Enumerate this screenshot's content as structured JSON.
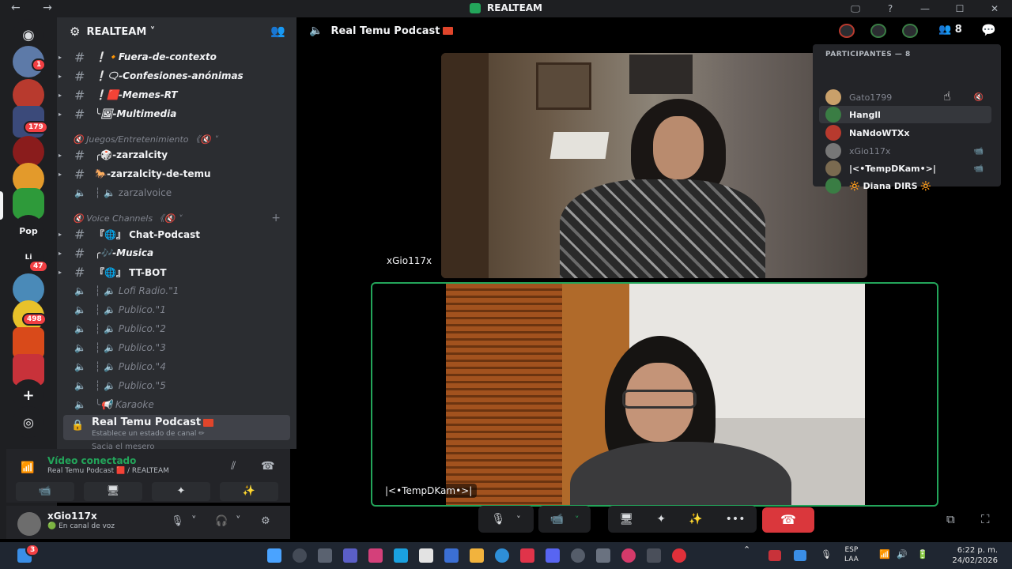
{
  "window": {
    "title": "REALTEAM",
    "nav_arrows": "← →",
    "controls": [
      "🖵",
      "?",
      "—",
      "☐",
      "✕"
    ]
  },
  "rail": {
    "badges": [
      "1",
      "179",
      "47",
      "498"
    ],
    "pop_label": "Pop",
    "li_label": "Li",
    "add_label": "+",
    "explore_label": "◎"
  },
  "guild": {
    "name": "REALTEAM ˅",
    "gear": "⚙",
    "invite": "👥"
  },
  "channels": [
    {
      "arrow": "▸",
      "name": "❕🔸Fuera-de-contexto"
    },
    {
      "arrow": "▸",
      "name": "❕🗨-Confesiones-anónimas"
    },
    {
      "arrow": "▸",
      "name": "❕🟥-Memes-RT"
    },
    {
      "arrow": "▸",
      "name": "╰🖼-Multimedia"
    }
  ],
  "categories": {
    "games": "🔇 Juegos/Entretenimiento 《🔇 ˅",
    "voice": "🔇 Voice Channels 《🔇 ˅"
  },
  "games_channels": [
    {
      "arrow": "▸",
      "icon": "#",
      "name": "╭🎲-zarzalcity"
    },
    {
      "arrow": "▸",
      "icon": "#",
      "name": "🐎-zarzalcity-de-temu"
    },
    {
      "arrow": "",
      "icon": "🔈",
      "name": "┆ 🔈 zarzalvoice"
    }
  ],
  "voice_channels": [
    {
      "arrow": "▸",
      "icon": "#",
      "name": "『🌐』 Chat-Podcast",
      "muted": false
    },
    {
      "arrow": "▸",
      "icon": "#",
      "name": "╭🎶-Musica",
      "muted": false
    },
    {
      "arrow": "▸",
      "icon": "#",
      "name": "『🌐』 TT-BOT",
      "muted": false
    },
    {
      "arrow": "",
      "icon": "🔈",
      "name": "┆ 🔈 Lofi Radio.\"1",
      "muted": true
    },
    {
      "arrow": "",
      "icon": "🔈",
      "name": "┆ 🔈 Publico.\"1",
      "muted": true
    },
    {
      "arrow": "",
      "icon": "🔈",
      "name": "┆ 🔈 Publico.\"2",
      "muted": true
    },
    {
      "arrow": "",
      "icon": "🔈",
      "name": "┆ 🔈 Publico.\"3",
      "muted": true
    },
    {
      "arrow": "",
      "icon": "🔈",
      "name": "┆ 🔈 Publico.\"4",
      "muted": true
    },
    {
      "arrow": "",
      "icon": "🔈",
      "name": "┆ 🔈 Publico.\"5",
      "muted": true
    },
    {
      "arrow": "",
      "icon": "🔈",
      "name": "╰📢 Karaoke",
      "muted": true
    }
  ],
  "selected_channel": {
    "name": "Real Temu Podcast",
    "status": "Establece un estado de canal ✏",
    "lock": "🔒",
    "peek": "Sacia el mesero"
  },
  "voice_panel": {
    "title": "Vídeo conectado",
    "subtitle": "Real Temu Podcast 🟥 / REALTEAM",
    "signal": "📶",
    "buttons": [
      "📹",
      "🖥",
      "✦",
      "✨"
    ]
  },
  "user": {
    "name": "xGio117x",
    "status": "🟢 En canal de voz",
    "icons": [
      "🎙",
      "˅",
      "🎧",
      "˅",
      "⚙"
    ]
  },
  "stage": {
    "channel_title": "Real Temu Podcast",
    "speaker_icon": "🔈",
    "people_count": "8",
    "people_icon": "👥",
    "chat_icon": "💬",
    "tile_top_label": "xGio117x",
    "tile_bottom_label": "|<•TempDKam•>|",
    "controls": [
      "🎙",
      "˅",
      "📹",
      "˅",
      "🖥",
      "✦",
      "✨",
      "•••"
    ],
    "leave_icon": "☎",
    "popout_icon": "⧉",
    "fullscreen_icon": "⛶"
  },
  "participants": {
    "header": "PARTICIPANTES — 8",
    "rows": [
      {
        "name": "Gato1799",
        "dim": true,
        "icon": "🔇",
        "color": "#c9a06a"
      },
      {
        "name": "Hangll",
        "dim": false,
        "icon": "",
        "color": "#3a7d44"
      },
      {
        "name": "NaNdoWTXx",
        "dim": false,
        "icon": "",
        "color": "#b83a2e"
      },
      {
        "name": "xGio117x",
        "dim": true,
        "icon": "📹",
        "color": "#777777"
      },
      {
        "name": "|<•TempDKam•>|",
        "dim": false,
        "icon": "📹",
        "color": "#7a6a50"
      },
      {
        "name": "🔆 Diana DIRS 🔆",
        "dim": false,
        "icon": "",
        "color": "#3a7d44"
      }
    ]
  },
  "taskbar": {
    "notif_badge": "3",
    "lang_top": "ESP",
    "lang_bottom": "LAA",
    "time": "6:22 p. m.",
    "date": "24/02/2026"
  },
  "colors": {
    "accent_green": "#23a55a",
    "danger_red": "#da373c",
    "sidebar": "#2b2d31",
    "rail": "#1e1f22"
  }
}
